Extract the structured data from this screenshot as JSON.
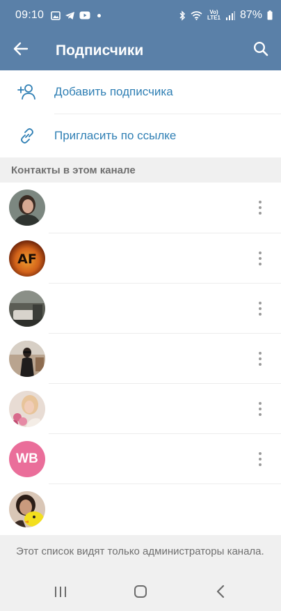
{
  "status_bar": {
    "time": "09:10",
    "network_label_top": "Vo)",
    "network_label_bottom": "LTE1",
    "battery": "87%"
  },
  "app_bar": {
    "title": "Подписчики"
  },
  "actions": {
    "add_subscriber": "Добавить подписчика",
    "invite_link": "Пригласить по ссылке"
  },
  "section": {
    "title": "Контакты в этом канале"
  },
  "contacts": [
    {
      "avatar": "photo-woman-dark-hair"
    },
    {
      "avatar": "photo-af-logo"
    },
    {
      "avatar": "photo-room-interior"
    },
    {
      "avatar": "photo-woman-sunglasses"
    },
    {
      "avatar": "photo-woman-flowers"
    },
    {
      "avatar": "initials",
      "initials": "WB",
      "color": "#ea6e9a"
    },
    {
      "avatar": "photo-woman-yellow-toy"
    }
  ],
  "footer": {
    "note": "Этот список видят только администраторы канала."
  },
  "colors": {
    "header": "#5a80a8",
    "accent": "#2f7fb4",
    "section_bg": "#f0f0f0"
  }
}
